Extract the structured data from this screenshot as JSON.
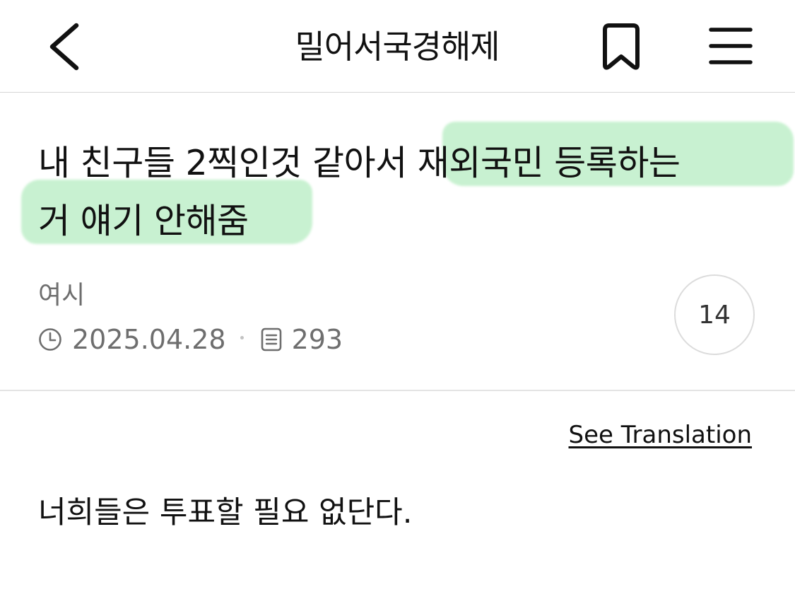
{
  "header": {
    "title": "밀어서국경해제"
  },
  "post": {
    "title_plain": "내 친구들 2찍인것 같아서 ",
    "title_highlight_1": "재외국민 등록하는",
    "title_highlight_2": "거 얘기 안해줌",
    "author": "여시",
    "date": "2025.04.28",
    "views": "293",
    "comment_count": "14",
    "highlight_color": "#c6f1cf"
  },
  "translation": {
    "label": "See Translation"
  },
  "body": {
    "text": "너희들은 투표할 필요 없단다."
  },
  "icons": {
    "back": "chevron-left-icon",
    "bookmark": "bookmark-icon",
    "menu": "hamburger-menu-icon",
    "clock": "clock-icon",
    "views": "document-icon"
  }
}
